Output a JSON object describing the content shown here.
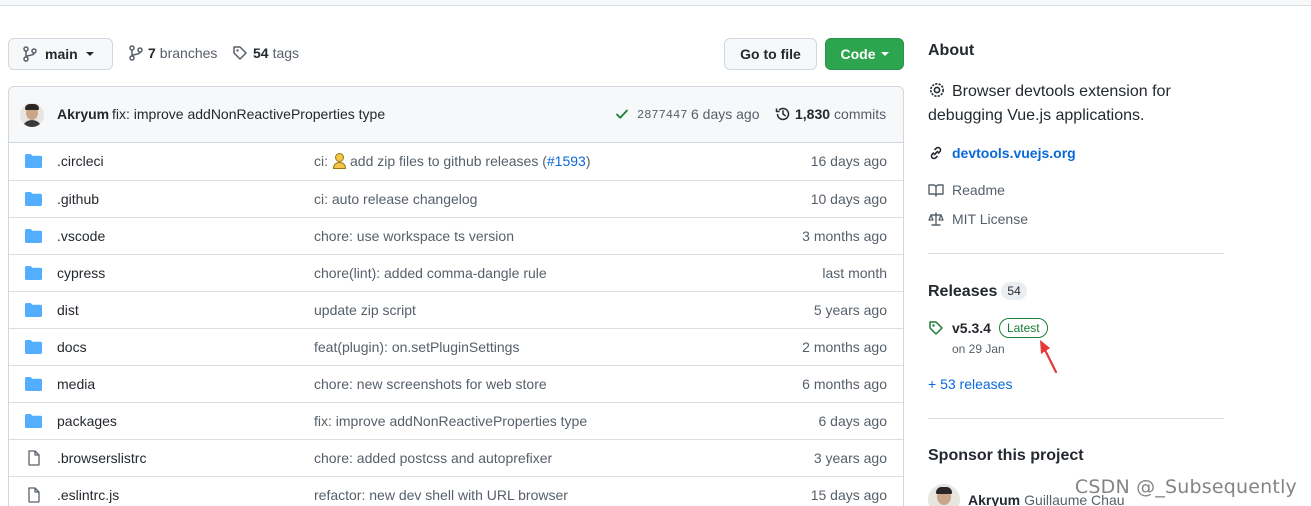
{
  "toolbar": {
    "branch_label": "main",
    "branches_count": "7",
    "branches_label": "branches",
    "tags_count": "54",
    "tags_label": "tags",
    "go_to_file": "Go to file",
    "code": "Code"
  },
  "latest_commit": {
    "author": "Akryum",
    "message": "fix: improve addNonReactiveProperties type",
    "sha": "2877447",
    "time": "6 days ago",
    "commits_count": "1,830",
    "commits_label": "commits"
  },
  "files": [
    {
      "type": "dir",
      "name": ".circleci",
      "msg_pre": "ci:",
      "msg_post": "add zip files to github releases (",
      "pr": "#1593",
      "msg_end": ")",
      "time": "16 days ago"
    },
    {
      "type": "dir",
      "name": ".github",
      "message": "ci: auto release changelog",
      "time": "10 days ago"
    },
    {
      "type": "dir",
      "name": ".vscode",
      "message": "chore: use workspace ts version",
      "time": "3 months ago"
    },
    {
      "type": "dir",
      "name": "cypress",
      "message": "chore(lint): added comma-dangle rule",
      "time": "last month"
    },
    {
      "type": "dir",
      "name": "dist",
      "message": "update zip script",
      "time": "5 years ago"
    },
    {
      "type": "dir",
      "name": "docs",
      "message": "feat(plugin): on.setPluginSettings",
      "time": "2 months ago"
    },
    {
      "type": "dir",
      "name": "media",
      "message": "chore: new screenshots for web store",
      "time": "6 months ago"
    },
    {
      "type": "dir",
      "name": "packages",
      "message": "fix: improve addNonReactiveProperties type",
      "time": "6 days ago"
    },
    {
      "type": "file",
      "name": ".browserslistrc",
      "message": "chore: added postcss and autoprefixer",
      "time": "3 years ago"
    },
    {
      "type": "file",
      "name": ".eslintrc.js",
      "message": "refactor: new dev shell with URL browser",
      "time": "15 days ago"
    }
  ],
  "about": {
    "heading": "About",
    "description": "Browser devtools extension for debugging Vue.js applications.",
    "homepage": "devtools.vuejs.org",
    "readme": "Readme",
    "license": "MIT License"
  },
  "releases": {
    "heading": "Releases",
    "count": "54",
    "version": "v5.3.4",
    "latest_badge": "Latest",
    "date": "on 29 Jan",
    "more": "+ 53 releases"
  },
  "sponsor": {
    "heading": "Sponsor this project",
    "login": "Akryum",
    "name": "Guillaume Chau"
  },
  "watermark": "CSDN @_Subsequently",
  "colors": {
    "accent_link": "#0969da",
    "code_button": "#2da44e",
    "folder_icon": "#54aeff",
    "latest_badge": "#1a7f37",
    "annotation_arrow": "#e53935"
  }
}
